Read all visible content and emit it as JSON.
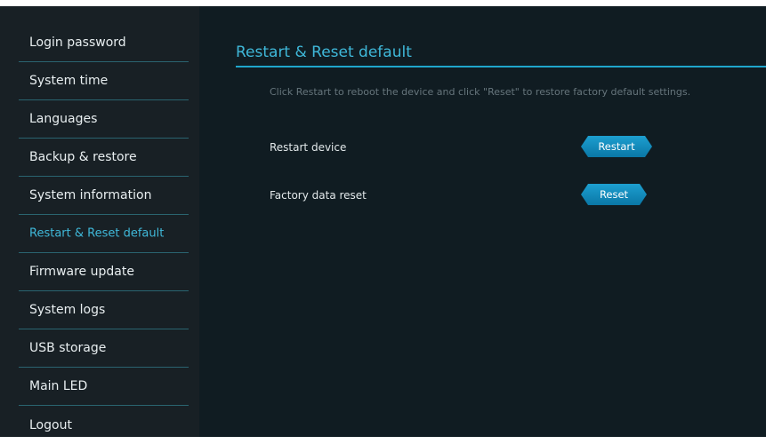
{
  "sidebar": {
    "items": [
      {
        "label": "Login password"
      },
      {
        "label": "System time"
      },
      {
        "label": "Languages"
      },
      {
        "label": "Backup & restore"
      },
      {
        "label": "System information"
      },
      {
        "label": "Restart & Reset default",
        "active": true
      },
      {
        "label": "Firmware update"
      },
      {
        "label": "System logs"
      },
      {
        "label": "USB storage"
      },
      {
        "label": "Main LED"
      },
      {
        "label": "Logout"
      }
    ]
  },
  "main": {
    "title": "Restart & Reset default",
    "description": "Click Restart to reboot the device and click \"Reset\" to restore factory default settings.",
    "rows": [
      {
        "label": "Restart device",
        "button": "Restart"
      },
      {
        "label": "Factory data reset",
        "button": "Reset"
      }
    ]
  },
  "colors": {
    "sidebar_bg": "#182025",
    "main_bg": "#101c22",
    "accent": "#3fb8d9",
    "button": "#1399c8"
  }
}
